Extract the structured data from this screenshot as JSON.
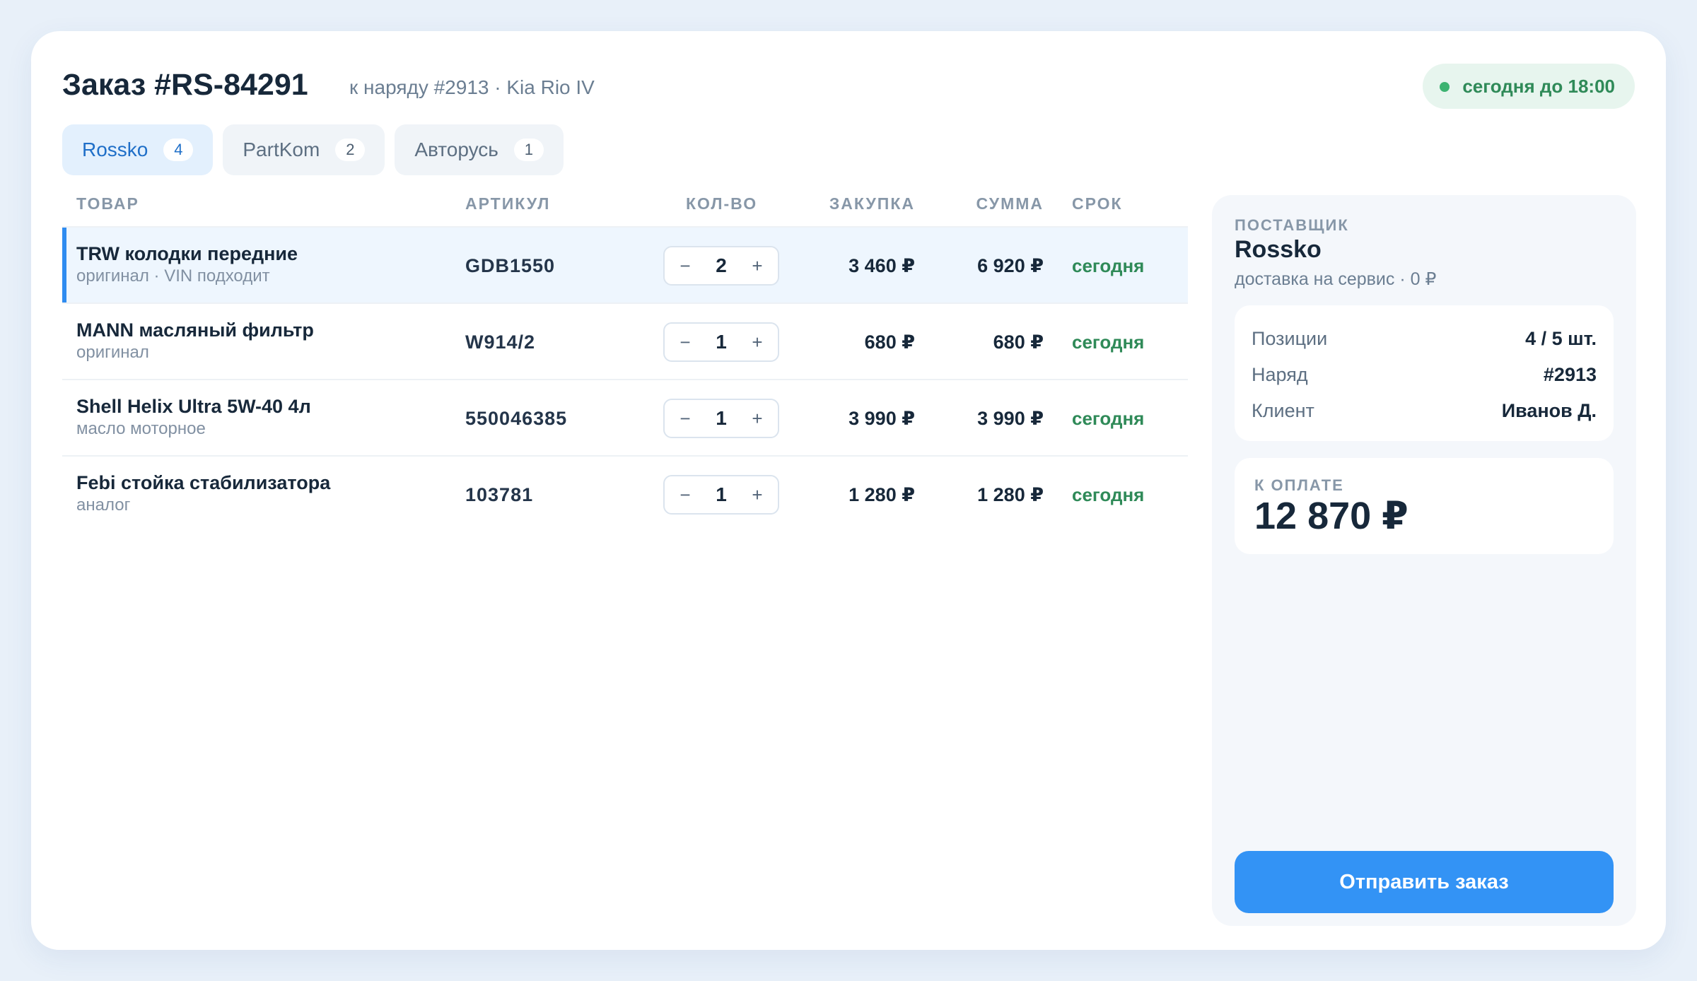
{
  "order": {
    "title": "Заказ #RS-84291",
    "subtitle": "к наряду #2913 · Kia Rio IV",
    "deadline": "сегодня до 18:00"
  },
  "tabs": [
    {
      "label": "Rossko",
      "count": "4"
    },
    {
      "label": "PartKom",
      "count": "2"
    },
    {
      "label": "Авторусь",
      "count": "1"
    }
  ],
  "table": {
    "headers": {
      "product": "ТОВАР",
      "article": "АРТИКУЛ",
      "qty": "КОЛ-ВО",
      "price": "ЗАКУПКА",
      "sum": "СУММА",
      "term": "СРОК"
    },
    "rows": [
      {
        "name": "TRW колодки передние",
        "note": "оригинал · VIN подходит",
        "article": "GDB1550",
        "qty": "2",
        "price": "3 460 ₽",
        "sum": "6 920 ₽",
        "term": "сегодня"
      },
      {
        "name": "MANN масляный фильтр",
        "note": "оригинал",
        "article": "W914/2",
        "qty": "1",
        "price": "680 ₽",
        "sum": "680 ₽",
        "term": "сегодня"
      },
      {
        "name": "Shell Helix Ultra 5W-40 4л",
        "note": "масло моторное",
        "article": "550046385",
        "qty": "1",
        "price": "3 990 ₽",
        "sum": "3 990 ₽",
        "term": "сегодня"
      },
      {
        "name": "Febi стойка стабилизатора",
        "note": "аналог",
        "article": "103781",
        "qty": "1",
        "price": "1 280 ₽",
        "sum": "1 280 ₽",
        "term": "сегодня"
      }
    ],
    "minus": "−",
    "plus": "+"
  },
  "panel": {
    "supplier_label": "ПОСТАВЩИК",
    "supplier_name": "Rossko",
    "delivery": "доставка на сервис · 0 ₽",
    "info": [
      {
        "key": "Позиции",
        "value": "4 / 5 шт."
      },
      {
        "key": "Наряд",
        "value": "#2913"
      },
      {
        "key": "Клиент",
        "value": "Иванов Д."
      }
    ],
    "pay_label": "К ОПЛАТЕ",
    "pay_amount": "12 870 ₽",
    "send_label": "Отправить заказ"
  },
  "colors": {
    "accent": "#3393f5",
    "success": "#2f8a58",
    "selected_row": "#eef6fe"
  }
}
